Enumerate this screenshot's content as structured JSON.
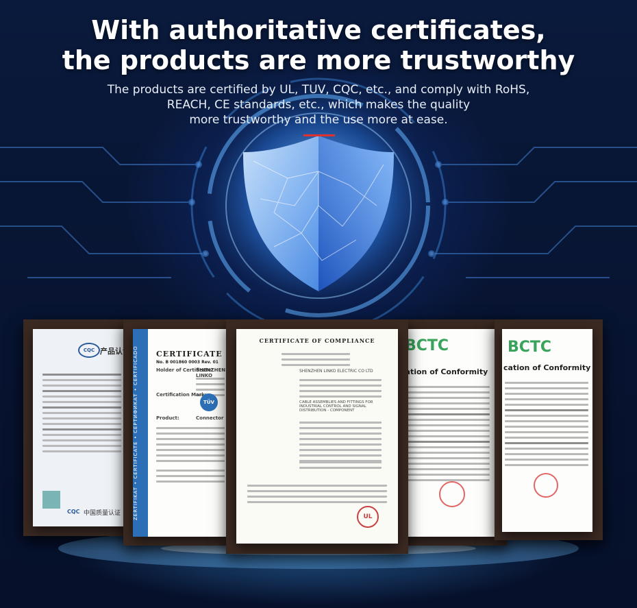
{
  "headline": {
    "line1": "With authoritative certificates,",
    "line2": "the products are more trustworthy"
  },
  "subtext": {
    "line1": "The products are certified by UL, TUV, CQC, etc., and comply with RoHS,",
    "line2": "REACH, CE standards, etc., which makes the quality",
    "line3": "more trustworthy and the use more at ease."
  },
  "certificates": {
    "cqc": {
      "logo": "CQC",
      "title": "产品认证",
      "footer_logo": "CQC",
      "footer_text": "中国质量认证"
    },
    "tuv": {
      "band": "ZERTIFIKAT • CERTIFICATE • СЕРТИФИКАТ • CERTIFICADO",
      "title": "CERTIFICATE",
      "number": "No. B 001860 0003 Rev. 01",
      "holder_label": "Holder of Certificate:",
      "holder": "SHENZHEN LINKO",
      "mark_label": "Certification Mark:",
      "mark": "TÜV",
      "product_label": "Product:",
      "product": "Connector"
    },
    "ul": {
      "title": "CERTIFICATE OF COMPLIANCE",
      "issued_to": "SHENZHEN LINKO ELECTRIC CO LTD",
      "product": "CABLE ASSEMBLIES AND FITTINGS FOR INDUSTRIAL CONTROL AND SIGNAL DISTRIBUTION - COMPONENT",
      "mark": "UL"
    },
    "bctc1": {
      "logo": "BCTC",
      "title": "cation of Conformity"
    },
    "bctc2": {
      "logo": "BCTC",
      "title": "cation of Conformity"
    }
  },
  "icons": [
    "shield-icon",
    "circuit-lines-icon"
  ],
  "colors": {
    "background": "#08132d",
    "accent_blue": "#2d6fb7",
    "bctc_green": "#3aa35b",
    "shield_red_mark": "#e03030"
  }
}
